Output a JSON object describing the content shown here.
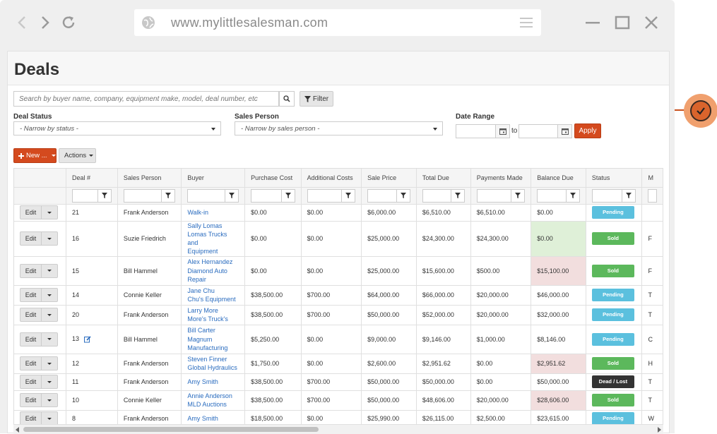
{
  "browser": {
    "url": "www.mylittlesalesman.com"
  },
  "page": {
    "title": "Deals",
    "search_placeholder": "Search by buyer name, company, equipment make, model, deal number, etc",
    "filter_label": "Filter",
    "deal_status": {
      "label": "Deal Status",
      "value": "- Narrow by status -"
    },
    "sales_person": {
      "label": "Sales Person",
      "value": "- Narrow by sales person -"
    },
    "date_range": {
      "label": "Date Range",
      "to": "to",
      "apply": "Apply"
    },
    "new_label": "New ...",
    "actions_label": "Actions"
  },
  "table": {
    "columns": [
      "",
      "Deal #",
      "Sales Person",
      "Buyer",
      "Purchase Cost",
      "Additional Costs",
      "Sale Price",
      "Total Due",
      "Payments Made",
      "Balance Due",
      "Status",
      "M"
    ],
    "edit_label": "Edit",
    "rows": [
      {
        "deal": "21",
        "sales": "Frank Anderson",
        "buyer": [
          "Walk-in"
        ],
        "purchase": "$0.00",
        "additional": "$0.00",
        "sale": "$6,000.00",
        "total": "$6,510.00",
        "payments": "$6,510.00",
        "balance": "$0.00",
        "balance_state": "none",
        "status": "Pending",
        "extra": ""
      },
      {
        "deal": "16",
        "sales": "Suzie Friedrich",
        "buyer": [
          "Sally Lomas",
          "Lomas Trucks and",
          "Equipment"
        ],
        "purchase": "$0.00",
        "additional": "$0.00",
        "sale": "$25,000.00",
        "total": "$24,300.00",
        "payments": "$24,300.00",
        "balance": "$0.00",
        "balance_state": "green",
        "status": "Sold",
        "extra": "F"
      },
      {
        "deal": "15",
        "sales": "Bill Hammel",
        "buyer": [
          "Alex Hernandez",
          "Diamond Auto",
          "Repair"
        ],
        "purchase": "$0.00",
        "additional": "$0.00",
        "sale": "$25,000.00",
        "total": "$15,600.00",
        "payments": "$500.00",
        "balance": "$15,100.00",
        "balance_state": "red",
        "status": "Sold",
        "extra": "F"
      },
      {
        "deal": "14",
        "sales": "Connie Keller",
        "buyer": [
          "Jane Chu",
          "Chu's Equipment"
        ],
        "purchase": "$38,500.00",
        "additional": "$700.00",
        "sale": "$64,000.00",
        "total": "$66,000.00",
        "payments": "$20,000.00",
        "balance": "$46,000.00",
        "balance_state": "none",
        "status": "Pending",
        "extra": "T"
      },
      {
        "deal": "20",
        "sales": "Frank Anderson",
        "buyer": [
          "Larry More",
          "More's Truck's"
        ],
        "purchase": "$38,500.00",
        "additional": "$700.00",
        "sale": "$50,000.00",
        "total": "$52,000.00",
        "payments": "$20,000.00",
        "balance": "$32,000.00",
        "balance_state": "none",
        "status": "Pending",
        "extra": "T"
      },
      {
        "deal": "13",
        "sales": "Bill Hammel",
        "buyer": [
          "Bill Carter",
          "Magnum",
          "Manufacturing"
        ],
        "purchase": "$5,250.00",
        "additional": "$0.00",
        "sale": "$9,000.00",
        "total": "$9,146.00",
        "payments": "$1,000.00",
        "balance": "$8,146.00",
        "balance_state": "none",
        "status": "Pending",
        "extra": "C",
        "note_icon": true
      },
      {
        "deal": "12",
        "sales": "Frank Anderson",
        "buyer": [
          "Steven Finner",
          "Global Hydraulics"
        ],
        "purchase": "$1,750.00",
        "additional": "$0.00",
        "sale": "$2,600.00",
        "total": "$2,951.62",
        "payments": "$0.00",
        "balance": "$2,951.62",
        "balance_state": "red",
        "status": "Sold",
        "extra": "H"
      },
      {
        "deal": "11",
        "sales": "Frank Anderson",
        "buyer": [
          "Amy Smith"
        ],
        "purchase": "$38,500.00",
        "additional": "$700.00",
        "sale": "$50,000.00",
        "total": "$50,000.00",
        "payments": "$0.00",
        "balance": "$50,000.00",
        "balance_state": "none",
        "status": "Dead / Lost",
        "extra": "T"
      },
      {
        "deal": "10",
        "sales": "Connie Keller",
        "buyer": [
          "Annie Anderson",
          "MLD Auctions"
        ],
        "purchase": "$38,500.00",
        "additional": "$700.00",
        "sale": "$50,000.00",
        "total": "$48,606.00",
        "payments": "$20,000.00",
        "balance": "$28,606.00",
        "balance_state": "red",
        "status": "Sold",
        "extra": "T"
      },
      {
        "deal": "8",
        "sales": "Frank Anderson",
        "buyer": [
          "Amy Smith"
        ],
        "purchase": "$18,500.00",
        "additional": "$0.00",
        "sale": "$25,990.00",
        "total": "$26,115.00",
        "payments": "$2,500.00",
        "balance": "$23,615.00",
        "balance_state": "none",
        "status": "Pending",
        "extra": "W"
      }
    ]
  },
  "colors": {
    "accent": "#d44a1e",
    "pending": "#5bc0de",
    "sold": "#5cb85c",
    "dead": "#333333",
    "link": "#2a6cbf"
  },
  "icons": {
    "back": "back-arrow-icon",
    "forward": "forward-arrow-icon",
    "reload": "reload-icon",
    "globe": "globe-icon",
    "menu": "hamburger-menu-icon",
    "minimize": "minimize-icon",
    "maximize": "maximize-icon",
    "close": "close-icon",
    "search": "search-icon",
    "filter": "filter-funnel-icon",
    "calendar": "calendar-icon",
    "plus": "plus-icon",
    "edit_note": "edit-note-icon",
    "check": "check-circle-icon"
  }
}
